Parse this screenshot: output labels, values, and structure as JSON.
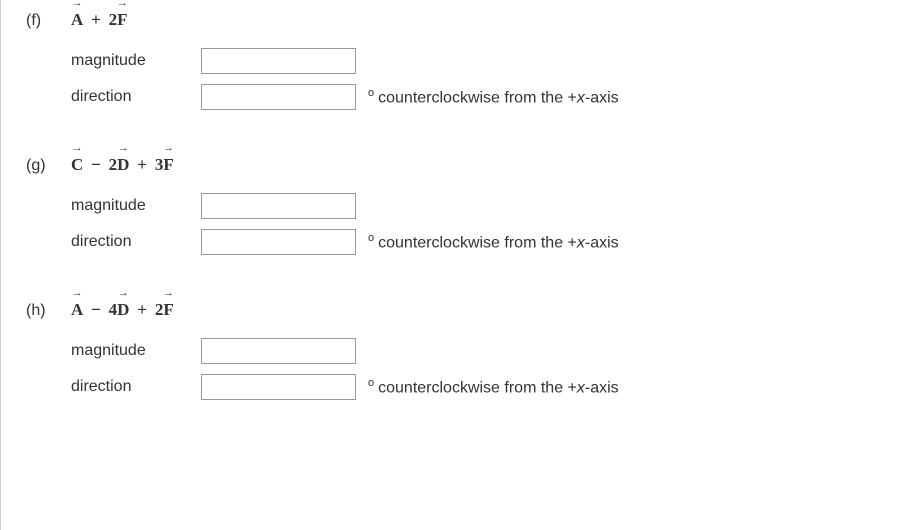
{
  "problems": [
    {
      "label": "(f)",
      "expr_plain": "A + 2F",
      "magnitude_label": "magnitude",
      "direction_label": "direction",
      "direction_suffix": "counterclockwise from the +",
      "direction_suffix_var": "x",
      "direction_suffix_end": "-axis"
    },
    {
      "label": "(g)",
      "expr_plain": "C − 2D + 3F",
      "magnitude_label": "magnitude",
      "direction_label": "direction",
      "direction_suffix": "counterclockwise from the +",
      "direction_suffix_var": "x",
      "direction_suffix_end": "-axis"
    },
    {
      "label": "(h)",
      "expr_plain": "A − 4D + 2F",
      "magnitude_label": "magnitude",
      "direction_label": "direction",
      "direction_suffix": "counterclockwise from the +",
      "direction_suffix_var": "x",
      "direction_suffix_end": "-axis"
    }
  ]
}
